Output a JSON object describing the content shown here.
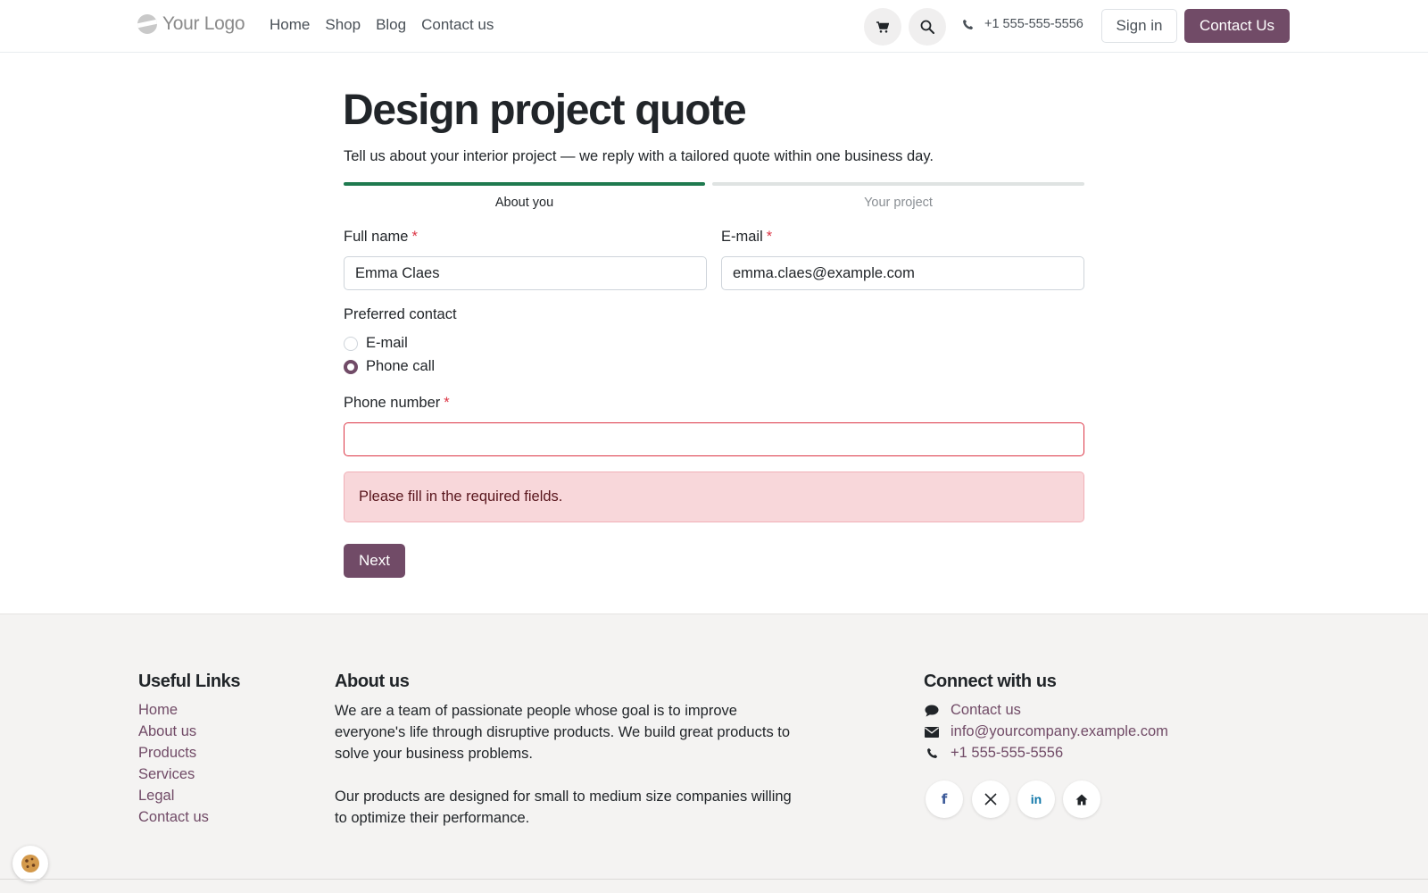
{
  "header": {
    "logo_text": "Your Logo",
    "nav": [
      "Home",
      "Shop",
      "Blog",
      "Contact us"
    ],
    "phone": "+1 555-555-5556",
    "sign_in": "Sign in",
    "contact_us": "Contact Us",
    "icons": {
      "cart": "cart-icon",
      "search": "search-icon",
      "phone": "phone-icon"
    }
  },
  "form": {
    "title": "Design project quote",
    "subtitle": "Tell us about your interior project — we reply with a tailored quote within one business day.",
    "steps": [
      {
        "label": "About you",
        "active": true
      },
      {
        "label": "Your project",
        "active": false
      }
    ],
    "full_name": {
      "label": "Full name",
      "required": "*",
      "value": "Emma Claes"
    },
    "email": {
      "label": "E-mail",
      "required": "*",
      "value": "emma.claes@example.com"
    },
    "preferred_contact": {
      "label": "Preferred contact",
      "options": [
        "E-mail",
        "Phone call"
      ],
      "selected": "Phone call"
    },
    "phone_number": {
      "label": "Phone number",
      "required": "*",
      "value": ""
    },
    "error": "Please fill in the required fields.",
    "next": "Next"
  },
  "footer": {
    "useful_links": {
      "title": "Useful Links",
      "items": [
        "Home",
        "About us",
        "Products",
        "Services",
        "Legal",
        "Contact us"
      ]
    },
    "about": {
      "title": "About us",
      "p1": "We are a team of passionate people whose goal is to improve everyone's life through disruptive products. We build great products to solve your business problems.",
      "p2": "Our products are designed for small to medium size companies willing to optimize their performance."
    },
    "connect": {
      "title": "Connect with us",
      "items": [
        {
          "icon": "chat-icon",
          "text": "Contact us"
        },
        {
          "icon": "envelope-icon",
          "text": "info@yourcompany.example.com"
        },
        {
          "icon": "phone-icon",
          "text": "+1 555-555-5556"
        }
      ],
      "social": [
        "facebook-icon",
        "x-icon",
        "linkedin-icon",
        "home-icon"
      ]
    }
  },
  "colors": {
    "primary": "#714b67",
    "progress": "#1f7a4f",
    "error": "#dc3545",
    "alert_bg": "#f8d7da",
    "footer_bg": "#f4f3f2"
  }
}
